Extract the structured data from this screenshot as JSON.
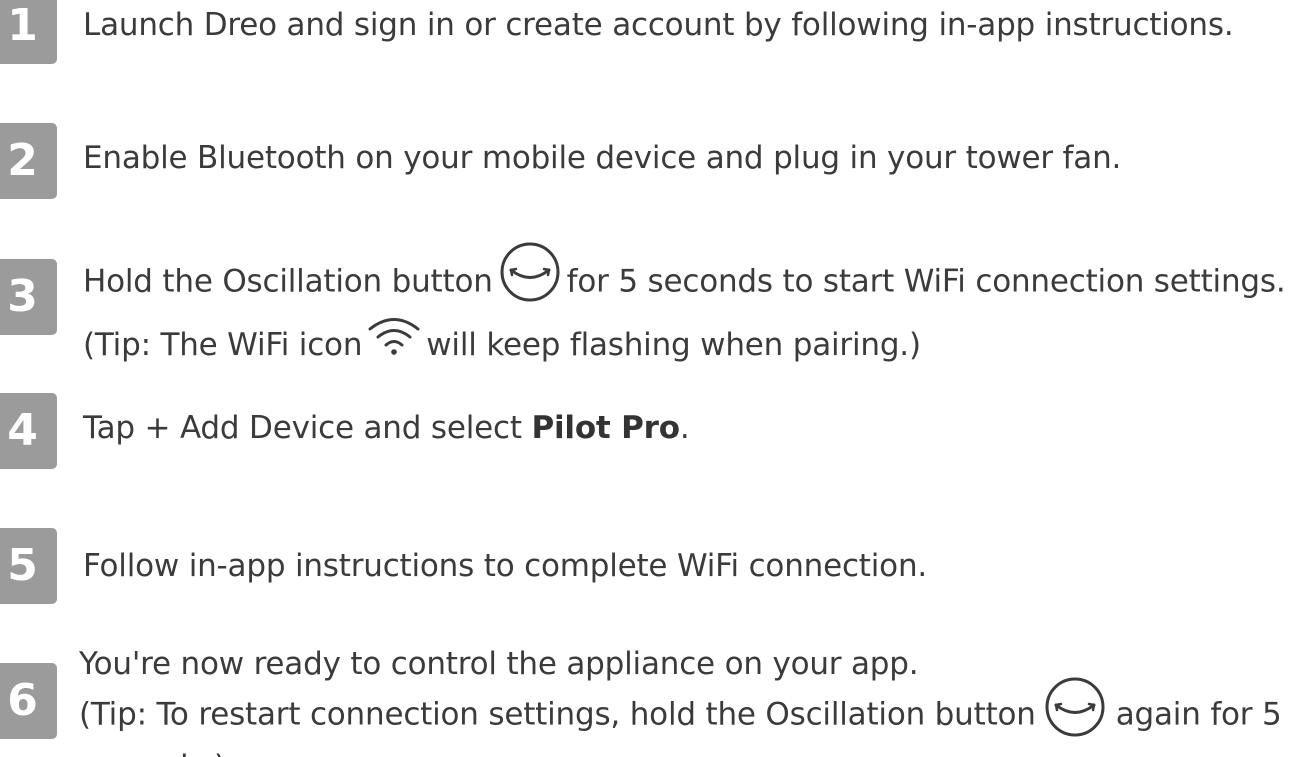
{
  "steps": [
    {
      "number": "1",
      "lines": [
        "Launch Dreo and sign in or create account by following in-app instructions."
      ]
    },
    {
      "number": "2",
      "lines": [
        "Enable Bluetooth on your mobile device and plug in your tower fan."
      ]
    },
    {
      "number": "3",
      "line1_before": "Hold the Oscillation button",
      "line1_after": "for 5 seconds to start WiFi connection settings.",
      "line2_before": "(Tip: The WiFi icon",
      "line2_after": "will keep flashing when pairing.)"
    },
    {
      "number": "4",
      "before": "Tap + Add Device and select ",
      "bold": "Pilot Pro",
      "after": "."
    },
    {
      "number": "5",
      "lines": [
        "Follow in-app instructions to complete WiFi connection."
      ]
    },
    {
      "number": "6",
      "line1": "You're now ready to control the appliance on your app.",
      "line2_before": "(Tip: To restart connection settings, hold the Oscillation button",
      "line2_after": "again for 5",
      "line3": "seconds.)"
    }
  ],
  "icons": {
    "oscillation": "oscillation-icon",
    "wifi": "wifi-icon"
  },
  "colors": {
    "badge": "#9b9b9b",
    "text": "#3b3b3b",
    "background": "#ffffff"
  }
}
